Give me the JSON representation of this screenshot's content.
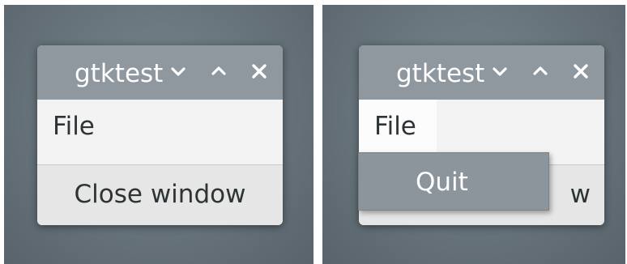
{
  "left": {
    "window": {
      "title": "gtktest",
      "icons": [
        "chevron-down-icon",
        "chevron-up-icon",
        "close-icon"
      ],
      "menubar": {
        "file_label": "File"
      },
      "button": {
        "label": "Close window"
      }
    }
  },
  "right": {
    "window": {
      "title": "gtktest",
      "icons": [
        "chevron-down-icon",
        "chevron-up-icon",
        "close-icon"
      ],
      "menubar": {
        "file_label": "File"
      },
      "button": {
        "label_visible": "w"
      },
      "popup": {
        "items": [
          {
            "label": "Quit"
          }
        ]
      }
    }
  },
  "colors": {
    "titlebar": "#8f979f",
    "popup": "#8d959c",
    "window_bg": "#ececec",
    "desktop": "#6b777f"
  }
}
